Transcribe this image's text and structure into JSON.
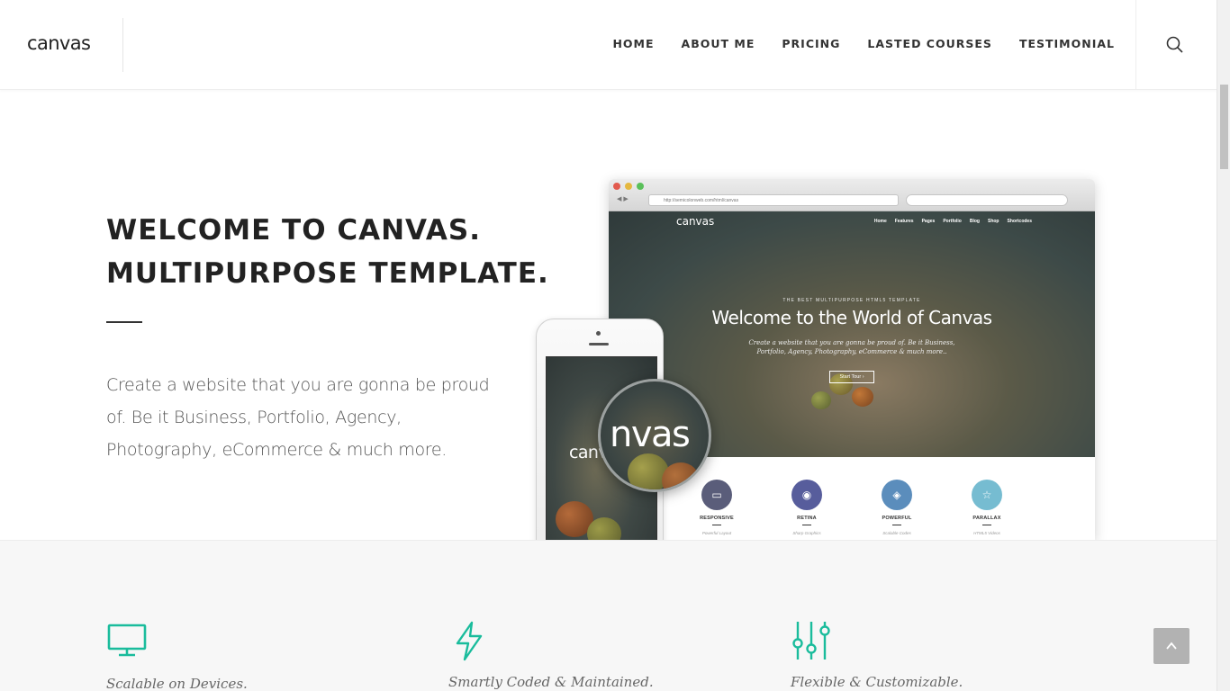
{
  "header": {
    "logo": "canvas",
    "nav": [
      "HOME",
      "ABOUT ME",
      "PRICING",
      "LASTED COURSES",
      "TESTIMONIAL"
    ],
    "search_icon": "search-icon"
  },
  "hero": {
    "title_line1": "WELCOME TO CANVAS.",
    "title_line2": "MULTIPURPOSE TEMPLATE.",
    "description": "Create a website that you are gonna be proud of. Be it Business, Portfolio, Agency, Photography, eCommerce & much more."
  },
  "mockup": {
    "url": "http://semicolonweb.com/html/canvas",
    "site_logo": "canvas",
    "site_nav": [
      "Home",
      "Features",
      "Pages",
      "Portfolio",
      "Blog",
      "Shop",
      "Shortcodes"
    ],
    "kicker": "THE BEST MULTIPURPOSE HTML5 TEMPLATE",
    "title": "Welcome to the World of Canvas",
    "subtitle": "Create a website that you are gonna be proud of. Be it Business, Portfolio, Agency, Photography, eCommerce & much more..",
    "button": "Start Tour ›",
    "features": [
      {
        "label": "RESPONSIVE",
        "caption": "Powerful Layout",
        "color": "#5a5d7a",
        "icon": "monitor-icon"
      },
      {
        "label": "RETINA",
        "caption": "Sharp Graphics",
        "color": "#575d9c",
        "icon": "eye-icon"
      },
      {
        "label": "POWERFUL",
        "caption": "Scalable Codes",
        "color": "#5b8dbc",
        "icon": "layers-icon"
      },
      {
        "label": "PARALLAX",
        "caption": "HTML5 Videos",
        "color": "#76bcd1",
        "icon": "star-icon"
      }
    ],
    "phone_text": "canvas",
    "magnifier_text": "nvas"
  },
  "features": [
    {
      "icon": "monitor-icon",
      "title": "Scalable on Devices."
    },
    {
      "icon": "lightning-icon",
      "title": "Smartly Coded & Maintained."
    },
    {
      "icon": "sliders-icon",
      "title": "Flexible & Customizable."
    }
  ],
  "colors": {
    "accent": "#1abc9c",
    "text_dark": "#222222",
    "bottom_bg": "#f7f7f7"
  }
}
